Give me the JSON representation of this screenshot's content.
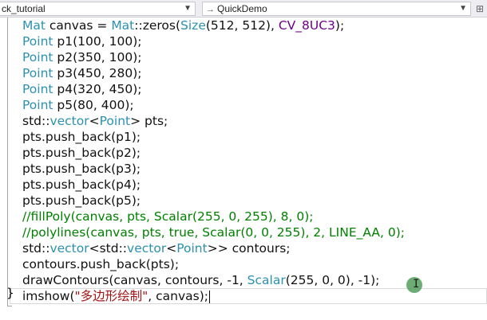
{
  "toolbar": {
    "left_dropdown": "ck_tutorial",
    "right_dropdown": "QuickDemo",
    "right_dropdown_icon": "→"
  },
  "code_lines": [
    {
      "tokens": [
        [
          "Mat",
          "type"
        ],
        [
          " canvas = ",
          "plain"
        ],
        [
          "Mat",
          "type"
        ],
        [
          "::zeros(",
          "plain"
        ],
        [
          "Size",
          "type"
        ],
        [
          "(512, 512), ",
          "plain"
        ],
        [
          "CV_8UC3",
          "macro"
        ],
        [
          ");",
          "plain"
        ]
      ]
    },
    {
      "tokens": [
        [
          "Point",
          "type"
        ],
        [
          " p1(100, 100);",
          "plain"
        ]
      ]
    },
    {
      "tokens": [
        [
          "Point",
          "type"
        ],
        [
          " p2(350, 100);",
          "plain"
        ]
      ]
    },
    {
      "tokens": [
        [
          "Point",
          "type"
        ],
        [
          " p3(450, 280);",
          "plain"
        ]
      ]
    },
    {
      "tokens": [
        [
          "Point",
          "type"
        ],
        [
          " p4(320, 450);",
          "plain"
        ]
      ]
    },
    {
      "tokens": [
        [
          "Point",
          "type"
        ],
        [
          " p5(80, 400);",
          "plain"
        ]
      ]
    },
    {
      "tokens": [
        [
          "std::",
          "plain"
        ],
        [
          "vector",
          "type"
        ],
        [
          "<",
          "plain"
        ],
        [
          "Point",
          "type"
        ],
        [
          "> pts;",
          "plain"
        ]
      ]
    },
    {
      "tokens": [
        [
          "pts.push_back(p1);",
          "plain"
        ]
      ]
    },
    {
      "tokens": [
        [
          "pts.push_back(p2);",
          "plain"
        ]
      ]
    },
    {
      "tokens": [
        [
          "pts.push_back(p3);",
          "plain"
        ]
      ]
    },
    {
      "tokens": [
        [
          "pts.push_back(p4);",
          "plain"
        ]
      ]
    },
    {
      "tokens": [
        [
          "pts.push_back(p5);",
          "plain"
        ]
      ]
    },
    {
      "tokens": [
        [
          "//fillPoly(canvas, pts, Scalar(255, 0, 255), 8, 0);",
          "comment"
        ]
      ]
    },
    {
      "tokens": [
        [
          "//polylines(canvas, pts, true, Scalar(0, 0, 255), 2, LINE_AA, 0);",
          "comment"
        ]
      ]
    },
    {
      "tokens": [
        [
          "std::",
          "plain"
        ],
        [
          "vector",
          "type"
        ],
        [
          "<std::",
          "plain"
        ],
        [
          "vector",
          "type"
        ],
        [
          "<",
          "plain"
        ],
        [
          "Point",
          "type"
        ],
        [
          ">> contours;",
          "plain"
        ]
      ]
    },
    {
      "tokens": [
        [
          "contours.push_back(pts);",
          "plain"
        ]
      ]
    },
    {
      "tokens": [
        [
          "drawContours(canvas, contours, -1, ",
          "plain"
        ],
        [
          "Scalar",
          "type"
        ],
        [
          "(255, 0, 0), -1);",
          "plain"
        ]
      ]
    },
    {
      "tokens": [
        [
          "imshow(",
          "plain"
        ],
        [
          "\"多边形绘制\"",
          "str"
        ],
        [
          ", canvas);",
          "plain"
        ]
      ],
      "caret": true
    }
  ],
  "closing_brace": "}",
  "colors": {
    "type": "#2b91af",
    "string": "#a31515",
    "macro": "#6f008a",
    "comment": "#008000",
    "plain": "#111111"
  },
  "icons": {
    "split": "split-window-icon"
  }
}
